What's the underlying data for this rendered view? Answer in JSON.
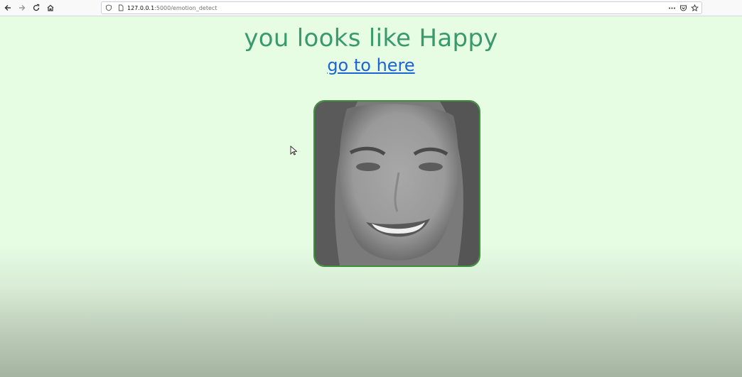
{
  "browser": {
    "url_host": "127.0.0.1",
    "url_rest": ":5000/emotion_detect",
    "icons": [
      "back-icon",
      "forward-icon",
      "reload-icon",
      "home-icon",
      "shield-icon",
      "page-icon",
      "more-icon",
      "pocket-icon",
      "bookmark-star-icon"
    ]
  },
  "page": {
    "headline": "you looks like Happy",
    "link_label": "go to here"
  },
  "colors": {
    "background": "#e6fde4",
    "headline": "#3a9a6c",
    "link": "#1d63d6",
    "photo_border": "#3f8f3f"
  }
}
